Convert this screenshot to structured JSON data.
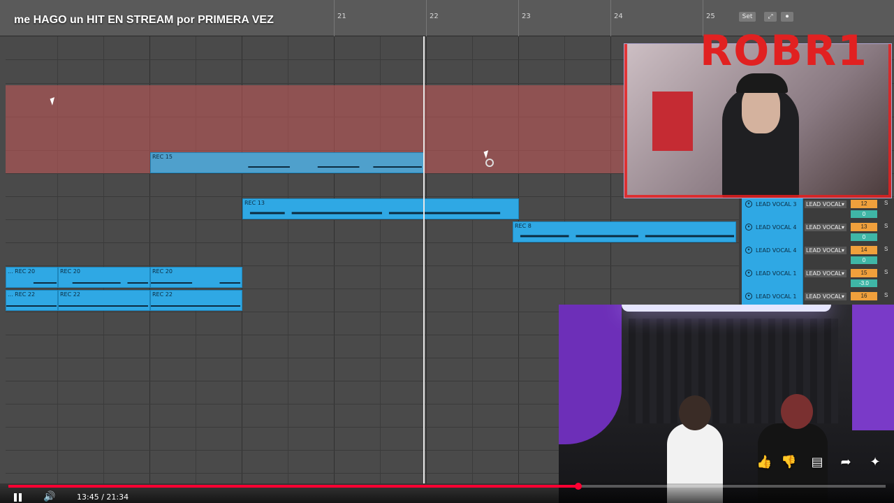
{
  "video": {
    "title": "me HAGO un HIT EN STREAM por PRIMERA VEZ",
    "progress_fraction": 0.65,
    "time_readout": "13:45 / 21:34"
  },
  "ruler": {
    "bars": [
      "21",
      "22",
      "23",
      "24",
      "25"
    ],
    "buttons": [
      "Set",
      "⤢",
      "⏺"
    ]
  },
  "clips": [
    {
      "name": "REC 15"
    },
    {
      "name": "REC 13"
    },
    {
      "name": "REC 8"
    },
    {
      "name": "... REC 20"
    },
    {
      "name": "REC 20"
    },
    {
      "name": "REC 20"
    },
    {
      "name": "... REC 22"
    },
    {
      "name": "REC 22"
    },
    {
      "name": "REC 22"
    }
  ],
  "tracks": [
    {
      "name": "LEAD VOCAL 3",
      "io": "LEAD VOCAL▾",
      "number": "12",
      "value": "0",
      "solo": "S"
    },
    {
      "name": "LEAD VOCAL 4",
      "io": "LEAD VOCAL▾",
      "number": "13",
      "value": "0",
      "solo": "S"
    },
    {
      "name": "LEAD VOCAL 4",
      "io": "LEAD VOCAL▾",
      "number": "14",
      "value": "0",
      "solo": "S"
    },
    {
      "name": "LEAD VOCAL 1",
      "io": "LEAD VOCAL▾",
      "number": "15",
      "value": "-3.0",
      "solo": "S"
    },
    {
      "name": "LEAD VOCAL 1",
      "io": "LEAD VOCAL▾",
      "number": "16",
      "value": "",
      "solo": "S"
    }
  ],
  "overlay": {
    "logo": "ROBR1",
    "icons": [
      "thumbs-up-icon",
      "thumbs-down-icon",
      "comment-icon",
      "share-icon",
      "sparkle-icon"
    ]
  },
  "colors": {
    "clip": "#2fa8e4",
    "selection": "#c85a5a",
    "progress": "#ff0033",
    "track_number": "#f0a03c",
    "track_value": "#3fb6a6"
  }
}
